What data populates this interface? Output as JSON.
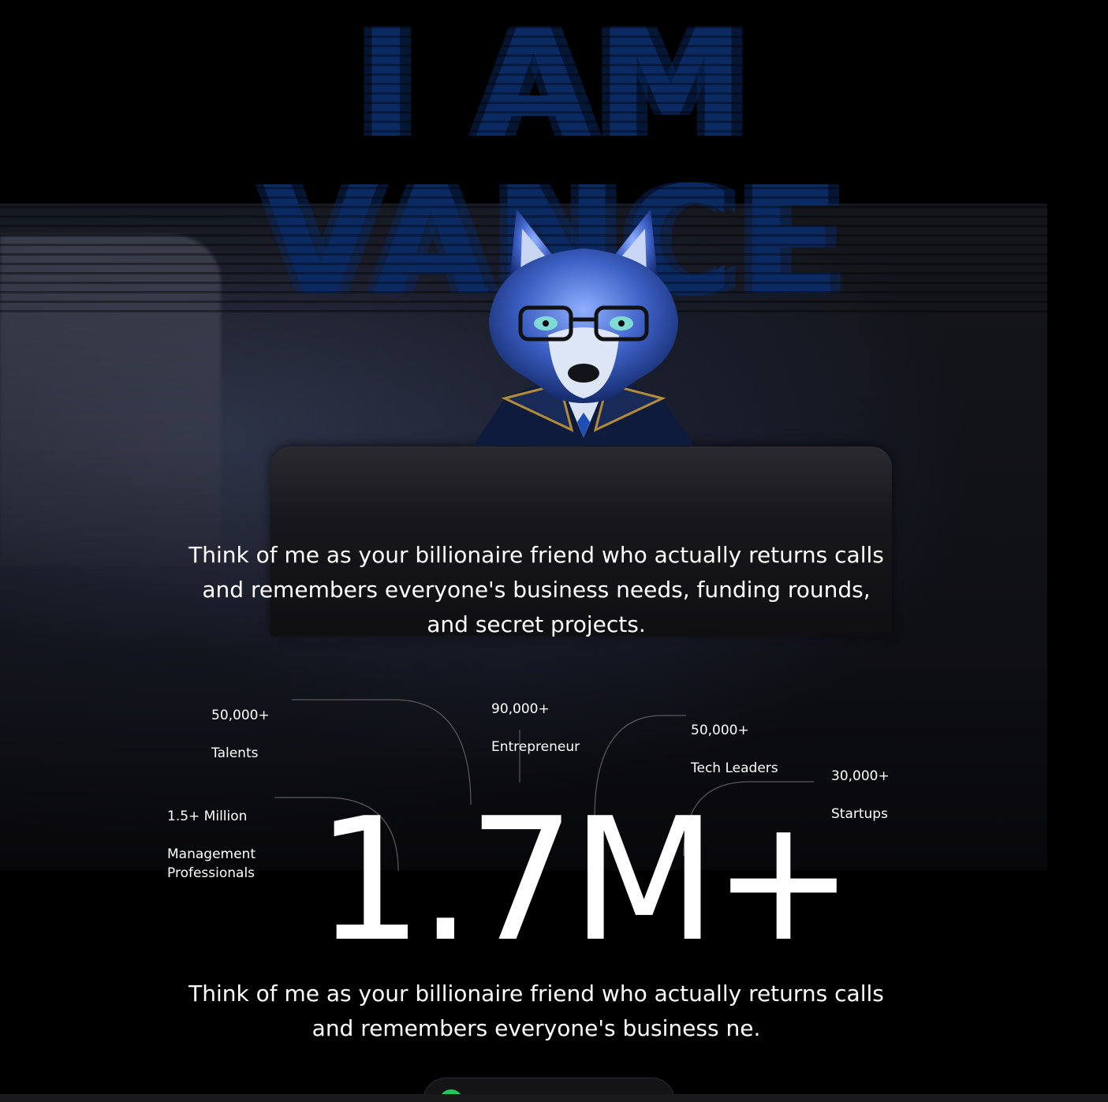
{
  "hero": {
    "title_line1": "I AM",
    "title_line2": "VANCE"
  },
  "tagline_top": "Think of me as your billionaire friend who actually returns calls and remembers everyone's business needs, funding rounds, and secret projects.",
  "stats": [
    {
      "value": "50,000+",
      "label": "Talents"
    },
    {
      "value": "90,000+",
      "label": "Entrepreneur"
    },
    {
      "value": "50,000+",
      "label": "Tech Leaders"
    },
    {
      "value": "30,000+",
      "label": "Startups"
    },
    {
      "value": "1.5+ Million",
      "label": "Management Professionals"
    }
  ],
  "total": "1.7M+",
  "tagline_bottom": "Think of me as your billionaire friend who actually returns calls and remembers everyone's business ne.",
  "colors": {
    "background": "#000000",
    "title": "#0b2a62",
    "cta_dot": "#27c25a"
  },
  "icons": {
    "mascot": "wolf-mascot-icon",
    "cta_status": "status-dot-icon"
  }
}
